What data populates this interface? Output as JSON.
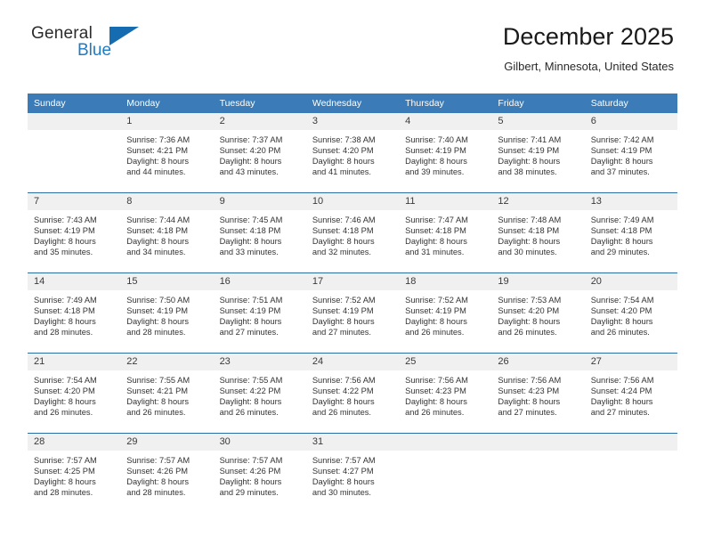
{
  "logo": {
    "word_one": "General",
    "word_two": "Blue",
    "triangle_icon": "blue-triangle-icon"
  },
  "header": {
    "title": "December 2025",
    "subtitle": "Gilbert, Minnesota, United States"
  },
  "colors": {
    "header_band": "#3b7cb8",
    "row_divider": "#2e6da4",
    "daynum_band": "#f0f0f0",
    "logo_blue": "#1f7ac4",
    "text": "#333333"
  },
  "weekdays": [
    "Sunday",
    "Monday",
    "Tuesday",
    "Wednesday",
    "Thursday",
    "Friday",
    "Saturday"
  ],
  "weeks": [
    [
      {
        "day": "",
        "lines": []
      },
      {
        "day": "1",
        "lines": [
          "Sunrise: 7:36 AM",
          "Sunset: 4:21 PM",
          "Daylight: 8 hours",
          "and 44 minutes."
        ]
      },
      {
        "day": "2",
        "lines": [
          "Sunrise: 7:37 AM",
          "Sunset: 4:20 PM",
          "Daylight: 8 hours",
          "and 43 minutes."
        ]
      },
      {
        "day": "3",
        "lines": [
          "Sunrise: 7:38 AM",
          "Sunset: 4:20 PM",
          "Daylight: 8 hours",
          "and 41 minutes."
        ]
      },
      {
        "day": "4",
        "lines": [
          "Sunrise: 7:40 AM",
          "Sunset: 4:19 PM",
          "Daylight: 8 hours",
          "and 39 minutes."
        ]
      },
      {
        "day": "5",
        "lines": [
          "Sunrise: 7:41 AM",
          "Sunset: 4:19 PM",
          "Daylight: 8 hours",
          "and 38 minutes."
        ]
      },
      {
        "day": "6",
        "lines": [
          "Sunrise: 7:42 AM",
          "Sunset: 4:19 PM",
          "Daylight: 8 hours",
          "and 37 minutes."
        ]
      }
    ],
    [
      {
        "day": "7",
        "lines": [
          "Sunrise: 7:43 AM",
          "Sunset: 4:19 PM",
          "Daylight: 8 hours",
          "and 35 minutes."
        ]
      },
      {
        "day": "8",
        "lines": [
          "Sunrise: 7:44 AM",
          "Sunset: 4:18 PM",
          "Daylight: 8 hours",
          "and 34 minutes."
        ]
      },
      {
        "day": "9",
        "lines": [
          "Sunrise: 7:45 AM",
          "Sunset: 4:18 PM",
          "Daylight: 8 hours",
          "and 33 minutes."
        ]
      },
      {
        "day": "10",
        "lines": [
          "Sunrise: 7:46 AM",
          "Sunset: 4:18 PM",
          "Daylight: 8 hours",
          "and 32 minutes."
        ]
      },
      {
        "day": "11",
        "lines": [
          "Sunrise: 7:47 AM",
          "Sunset: 4:18 PM",
          "Daylight: 8 hours",
          "and 31 minutes."
        ]
      },
      {
        "day": "12",
        "lines": [
          "Sunrise: 7:48 AM",
          "Sunset: 4:18 PM",
          "Daylight: 8 hours",
          "and 30 minutes."
        ]
      },
      {
        "day": "13",
        "lines": [
          "Sunrise: 7:49 AM",
          "Sunset: 4:18 PM",
          "Daylight: 8 hours",
          "and 29 minutes."
        ]
      }
    ],
    [
      {
        "day": "14",
        "lines": [
          "Sunrise: 7:49 AM",
          "Sunset: 4:18 PM",
          "Daylight: 8 hours",
          "and 28 minutes."
        ]
      },
      {
        "day": "15",
        "lines": [
          "Sunrise: 7:50 AM",
          "Sunset: 4:19 PM",
          "Daylight: 8 hours",
          "and 28 minutes."
        ]
      },
      {
        "day": "16",
        "lines": [
          "Sunrise: 7:51 AM",
          "Sunset: 4:19 PM",
          "Daylight: 8 hours",
          "and 27 minutes."
        ]
      },
      {
        "day": "17",
        "lines": [
          "Sunrise: 7:52 AM",
          "Sunset: 4:19 PM",
          "Daylight: 8 hours",
          "and 27 minutes."
        ]
      },
      {
        "day": "18",
        "lines": [
          "Sunrise: 7:52 AM",
          "Sunset: 4:19 PM",
          "Daylight: 8 hours",
          "and 26 minutes."
        ]
      },
      {
        "day": "19",
        "lines": [
          "Sunrise: 7:53 AM",
          "Sunset: 4:20 PM",
          "Daylight: 8 hours",
          "and 26 minutes."
        ]
      },
      {
        "day": "20",
        "lines": [
          "Sunrise: 7:54 AM",
          "Sunset: 4:20 PM",
          "Daylight: 8 hours",
          "and 26 minutes."
        ]
      }
    ],
    [
      {
        "day": "21",
        "lines": [
          "Sunrise: 7:54 AM",
          "Sunset: 4:20 PM",
          "Daylight: 8 hours",
          "and 26 minutes."
        ]
      },
      {
        "day": "22",
        "lines": [
          "Sunrise: 7:55 AM",
          "Sunset: 4:21 PM",
          "Daylight: 8 hours",
          "and 26 minutes."
        ]
      },
      {
        "day": "23",
        "lines": [
          "Sunrise: 7:55 AM",
          "Sunset: 4:22 PM",
          "Daylight: 8 hours",
          "and 26 minutes."
        ]
      },
      {
        "day": "24",
        "lines": [
          "Sunrise: 7:56 AM",
          "Sunset: 4:22 PM",
          "Daylight: 8 hours",
          "and 26 minutes."
        ]
      },
      {
        "day": "25",
        "lines": [
          "Sunrise: 7:56 AM",
          "Sunset: 4:23 PM",
          "Daylight: 8 hours",
          "and 26 minutes."
        ]
      },
      {
        "day": "26",
        "lines": [
          "Sunrise: 7:56 AM",
          "Sunset: 4:23 PM",
          "Daylight: 8 hours",
          "and 27 minutes."
        ]
      },
      {
        "day": "27",
        "lines": [
          "Sunrise: 7:56 AM",
          "Sunset: 4:24 PM",
          "Daylight: 8 hours",
          "and 27 minutes."
        ]
      }
    ],
    [
      {
        "day": "28",
        "lines": [
          "Sunrise: 7:57 AM",
          "Sunset: 4:25 PM",
          "Daylight: 8 hours",
          "and 28 minutes."
        ]
      },
      {
        "day": "29",
        "lines": [
          "Sunrise: 7:57 AM",
          "Sunset: 4:26 PM",
          "Daylight: 8 hours",
          "and 28 minutes."
        ]
      },
      {
        "day": "30",
        "lines": [
          "Sunrise: 7:57 AM",
          "Sunset: 4:26 PM",
          "Daylight: 8 hours",
          "and 29 minutes."
        ]
      },
      {
        "day": "31",
        "lines": [
          "Sunrise: 7:57 AM",
          "Sunset: 4:27 PM",
          "Daylight: 8 hours",
          "and 30 minutes."
        ]
      },
      {
        "day": "",
        "lines": []
      },
      {
        "day": "",
        "lines": []
      },
      {
        "day": "",
        "lines": []
      }
    ]
  ]
}
